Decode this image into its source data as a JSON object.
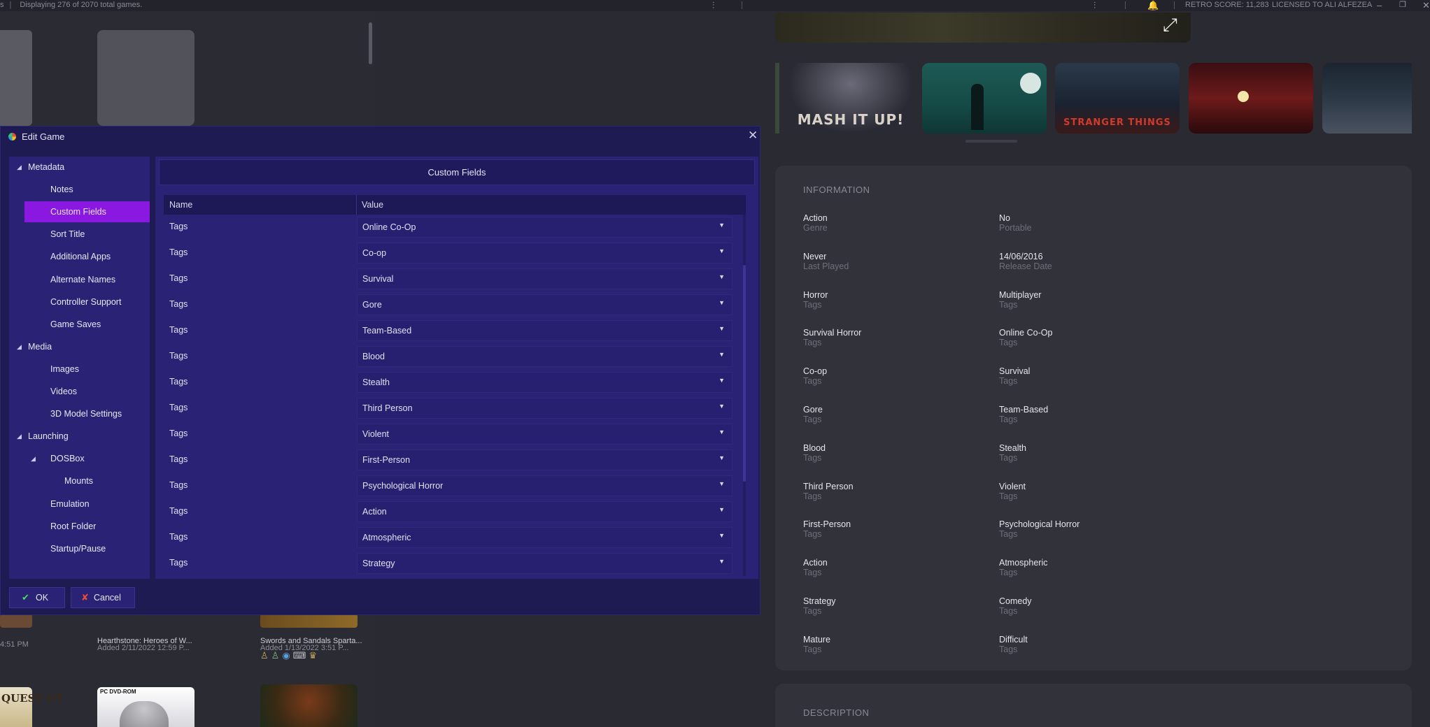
{
  "topbar": {
    "status": "Displaying 276 of 2070 total games.",
    "retro_score": "RETRO SCORE: 11,283",
    "license": "LICENSED TO ALI ALFEZEA",
    "icons": [
      "filter-sliders-icon",
      "bell-icon",
      "minimize-icon",
      "restore-icon",
      "close-icon"
    ]
  },
  "library": {
    "tiles": [
      {
        "caption": "Hearthstone: Heroes of W...",
        "subtitle": "Added 2/11/2022 12:59 P..."
      },
      {
        "caption": "Swords and Sandals Sparta...",
        "subtitle": "Added 1/13/2022 3:51 P..."
      }
    ],
    "left_time": "4:51 PM",
    "left_cover_text": "QUEST OT",
    "cover_badge": "PC DVD-ROM"
  },
  "details": {
    "thumbnails": [
      "MASH IT UP!",
      "",
      "STRANGER THINGS",
      "",
      ""
    ],
    "information_title": "INFORMATION",
    "description_title": "DESCRIPTION",
    "fields": [
      {
        "value": "Action",
        "key": "Genre"
      },
      {
        "value": "No",
        "key": "Portable"
      },
      {
        "value": "Never",
        "key": "Last Played"
      },
      {
        "value": "14/06/2016",
        "key": "Release Date"
      },
      {
        "value": "Horror",
        "key": "Tags"
      },
      {
        "value": "Multiplayer",
        "key": "Tags"
      },
      {
        "value": "Survival Horror",
        "key": "Tags"
      },
      {
        "value": "Online Co-Op",
        "key": "Tags"
      },
      {
        "value": "Co-op",
        "key": "Tags"
      },
      {
        "value": "Survival",
        "key": "Tags"
      },
      {
        "value": "Gore",
        "key": "Tags"
      },
      {
        "value": "Team-Based",
        "key": "Tags"
      },
      {
        "value": "Blood",
        "key": "Tags"
      },
      {
        "value": "Stealth",
        "key": "Tags"
      },
      {
        "value": "Third Person",
        "key": "Tags"
      },
      {
        "value": "Violent",
        "key": "Tags"
      },
      {
        "value": "First-Person",
        "key": "Tags"
      },
      {
        "value": "Psychological Horror",
        "key": "Tags"
      },
      {
        "value": "Action",
        "key": "Tags"
      },
      {
        "value": "Atmospheric",
        "key": "Tags"
      },
      {
        "value": "Strategy",
        "key": "Tags"
      },
      {
        "value": "Comedy",
        "key": "Tags"
      },
      {
        "value": "Mature",
        "key": "Tags"
      },
      {
        "value": "Difficult",
        "key": "Tags"
      }
    ]
  },
  "dialog": {
    "title": "Edit Game",
    "header": "Custom Fields",
    "columns": {
      "name": "Name",
      "value": "Value"
    },
    "tree": [
      {
        "label": "Metadata",
        "level": 0,
        "expanded": true
      },
      {
        "label": "Notes",
        "level": 1
      },
      {
        "label": "Custom Fields",
        "level": 1,
        "selected": true
      },
      {
        "label": "Sort Title",
        "level": 1
      },
      {
        "label": "Additional Apps",
        "level": 1
      },
      {
        "label": "Alternate Names",
        "level": 1
      },
      {
        "label": "Controller Support",
        "level": 1
      },
      {
        "label": "Game Saves",
        "level": 1
      },
      {
        "label": "Media",
        "level": 0,
        "expanded": true
      },
      {
        "label": "Images",
        "level": 1
      },
      {
        "label": "Videos",
        "level": 1
      },
      {
        "label": "3D Model Settings",
        "level": 1
      },
      {
        "label": "Launching",
        "level": 0,
        "expanded": true
      },
      {
        "label": "DOSBox",
        "level": 1,
        "expanded": true
      },
      {
        "label": "Mounts",
        "level": 2
      },
      {
        "label": "Emulation",
        "level": 1
      },
      {
        "label": "Root Folder",
        "level": 1
      },
      {
        "label": "Startup/Pause",
        "level": 1
      }
    ],
    "rows": [
      {
        "name": "Tags",
        "value": "Online Co-Op"
      },
      {
        "name": "Tags",
        "value": "Co-op"
      },
      {
        "name": "Tags",
        "value": "Survival"
      },
      {
        "name": "Tags",
        "value": "Gore"
      },
      {
        "name": "Tags",
        "value": "Team-Based"
      },
      {
        "name": "Tags",
        "value": "Blood"
      },
      {
        "name": "Tags",
        "value": "Stealth"
      },
      {
        "name": "Tags",
        "value": "Third Person"
      },
      {
        "name": "Tags",
        "value": "Violent"
      },
      {
        "name": "Tags",
        "value": "First-Person"
      },
      {
        "name": "Tags",
        "value": "Psychological Horror"
      },
      {
        "name": "Tags",
        "value": "Action"
      },
      {
        "name": "Tags",
        "value": "Atmospheric"
      },
      {
        "name": "Tags",
        "value": "Strategy"
      }
    ],
    "ok_label": "OK",
    "cancel_label": "Cancel"
  }
}
